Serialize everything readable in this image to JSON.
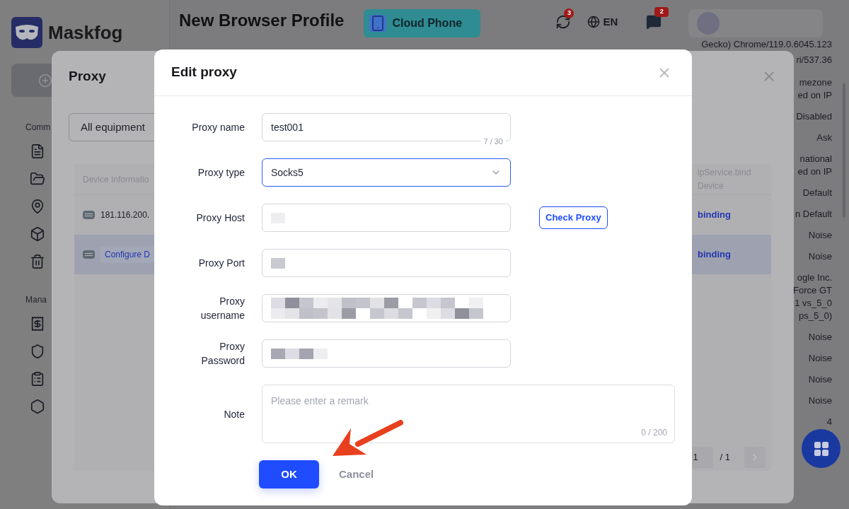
{
  "sidebar": {
    "logo": "Maskfog",
    "sections": [
      {
        "label": "Comm"
      },
      {
        "label": "Mana"
      }
    ]
  },
  "header": {
    "title": "New Browser Profile",
    "cloud_phone": "Cloud Phone",
    "sync_badge": "3",
    "language": "EN",
    "messages_badge": "2"
  },
  "settings_values": [
    {
      "lines": [
        "Gecko) Chrome/119.0.6045.123",
        "ri/537.36"
      ]
    },
    {
      "lines": [
        "mezone",
        "ed on IP"
      ]
    },
    {
      "lines": [
        "Disabled"
      ]
    },
    {
      "lines": [
        "Ask"
      ]
    },
    {
      "lines": [
        "national",
        "ed on IP"
      ]
    },
    {
      "lines": [
        "Default"
      ]
    },
    {
      "lines": [
        "n Default"
      ]
    },
    {
      "lines": [
        "Noise"
      ]
    },
    {
      "lines": [
        "Noise"
      ]
    },
    {
      "lines": [
        "ogle Inc.",
        "Force GT",
        "1 vs_5_0",
        "ps_5_0)"
      ]
    },
    {
      "lines": [
        "Noise"
      ]
    },
    {
      "lines": [
        "Noise"
      ]
    },
    {
      "lines": [
        "Noise"
      ]
    },
    {
      "lines": [
        "Noise"
      ]
    },
    {
      "lines": [
        "4"
      ]
    }
  ],
  "proxy_dialog": {
    "title": "Proxy",
    "filter": "All equipment",
    "columns": [
      "Device Informatio",
      "ipService.bind Device"
    ],
    "rows": [
      {
        "kind": "ip",
        "device": "181.116.200.",
        "bind": "binding",
        "selected": false
      },
      {
        "kind": "configure",
        "device": "Configure D",
        "bind": "binding",
        "selected": true
      }
    ],
    "pagination": {
      "page": "1",
      "total": "/ 1"
    }
  },
  "edit_dialog": {
    "title": "Edit proxy",
    "fields": [
      {
        "kind": "text",
        "label": "Proxy name",
        "value": "test001",
        "counter": "7 / 30",
        "focused": false
      },
      {
        "kind": "select",
        "label": "Proxy type",
        "value": "Socks5",
        "focused": true
      },
      {
        "kind": "masked",
        "label": "Proxy Host",
        "action": "Check Proxy"
      },
      {
        "kind": "masked",
        "label": "Proxy Port"
      },
      {
        "kind": "masked",
        "label": "Proxy username"
      },
      {
        "kind": "masked",
        "label": "Proxy Password"
      },
      {
        "kind": "textarea",
        "label": "Note",
        "placeholder": "Please enter a remark",
        "counter": "0 / 200"
      }
    ],
    "buttons": [
      {
        "label": "OK",
        "kind": "primary"
      },
      {
        "label": "Cancel",
        "kind": "text"
      }
    ]
  }
}
